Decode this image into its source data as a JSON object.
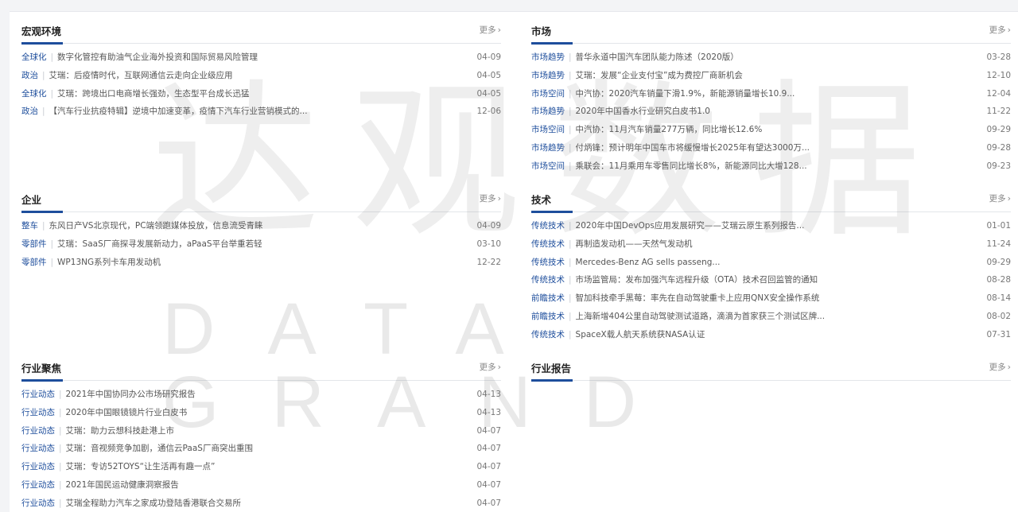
{
  "sections": [
    {
      "key": "macro",
      "title": "宏观环境",
      "more": "更多",
      "rows": [
        {
          "tag": "全球化",
          "text": "数字化管控有助油气企业海外投资和国际贸易风险管理",
          "date": "04-09"
        },
        {
          "tag": "政治",
          "text": "艾瑞：后疫情时代，互联网通信云走向企业级应用",
          "date": "04-05"
        },
        {
          "tag": "全球化",
          "text": "艾瑞：跨境出口电商增长强劲，生态型平台成长迅猛",
          "date": "04-05"
        },
        {
          "tag": "政治",
          "text": "【汽车行业抗疫特辑】逆境中加速变革，疫情下汽车行业营销模式的...",
          "date": "12-06"
        }
      ]
    },
    {
      "key": "market",
      "title": "市场",
      "more": "更多",
      "rows": [
        {
          "tag": "市场趋势",
          "text": "普华永道中国汽车团队能力陈述（2020版）",
          "date": "03-28"
        },
        {
          "tag": "市场趋势",
          "text": "艾瑞：发展“企业支付宝”成为费控厂商新机会",
          "date": "12-10"
        },
        {
          "tag": "市场空间",
          "text": "中汽协：2020汽车销量下滑1.9%，新能源销量增长10.9...",
          "date": "12-04"
        },
        {
          "tag": "市场趋势",
          "text": "2020年中国香水行业研究白皮书1.0",
          "date": "11-22"
        },
        {
          "tag": "市场空间",
          "text": "中汽协：11月汽车销量277万辆，同比增长12.6%",
          "date": "09-29"
        },
        {
          "tag": "市场趋势",
          "text": "付炳锋：预计明年中国车市将缓慢增长2025年有望达3000万...",
          "date": "09-28"
        },
        {
          "tag": "市场空间",
          "text": "乘联会：11月乘用车零售同比增长8%，新能源同比大增128...",
          "date": "09-23"
        }
      ]
    },
    {
      "key": "enterprise",
      "title": "企业",
      "more": "更多",
      "rows": [
        {
          "tag": "整车",
          "text": "东风日产VS北京现代，PC端领跑媒体投放，信息流受青睐",
          "date": "04-09"
        },
        {
          "tag": "零部件",
          "text": "艾瑞：SaaS厂商探寻发展新动力，aPaaS平台举重若轻",
          "date": "03-10"
        },
        {
          "tag": "零部件",
          "text": "WP13NG系列卡车用发动机",
          "date": "12-22"
        }
      ]
    },
    {
      "key": "tech",
      "title": "技术",
      "more": "更多",
      "rows": [
        {
          "tag": "传统技术",
          "text": "2020年中国DevOps应用发展研究——艾瑞云原生系列报告...",
          "date": "01-01"
        },
        {
          "tag": "传统技术",
          "text": "再制造发动机——天然气发动机",
          "date": "11-24"
        },
        {
          "tag": "传统技术",
          "text": "Mercedes-Benz AG sells passeng...",
          "date": "09-29"
        },
        {
          "tag": "传统技术",
          "text": "市场监管局：发布加强汽车远程升级（OTA）技术召回监管的通知",
          "date": "08-28"
        },
        {
          "tag": "前瞻技术",
          "text": "智加科技牵手黑莓：率先在自动驾驶重卡上应用QNX安全操作系统",
          "date": "08-14"
        },
        {
          "tag": "前瞻技术",
          "text": "上海新增404公里自动驾驶测试道路，滴滴为首家获三个测试区牌...",
          "date": "08-02"
        },
        {
          "tag": "传统技术",
          "text": "SpaceX载人航天系统获NASA认证",
          "date": "07-31"
        }
      ]
    },
    {
      "key": "focus",
      "title": "行业聚焦",
      "more": "更多",
      "rows": [
        {
          "tag": "行业动态",
          "text": "2021年中国协同办公市场研究报告",
          "date": "04-13"
        },
        {
          "tag": "行业动态",
          "text": "2020年中国眼镜镜片行业白皮书",
          "date": "04-13"
        },
        {
          "tag": "行业动态",
          "text": "艾瑞：助力云想科技赴港上市",
          "date": "04-07"
        },
        {
          "tag": "行业动态",
          "text": "艾瑞：音视频竞争加剧，通信云PaaS厂商突出重围",
          "date": "04-07"
        },
        {
          "tag": "行业动态",
          "text": "艾瑞：专访52TOYS“让生活再有趣一点”",
          "date": "04-07"
        },
        {
          "tag": "行业动态",
          "text": "2021年国民运动健康洞察报告",
          "date": "04-07"
        },
        {
          "tag": "行业动态",
          "text": "艾瑞全程助力汽车之家成功登陆香港联合交易所",
          "date": "04-07"
        }
      ]
    },
    {
      "key": "report",
      "title": "行业报告",
      "more": "更多",
      "rows": []
    }
  ],
  "watermark": {
    "cn": "达观数据",
    "en": "DATA GRAND"
  },
  "colors": {
    "accent": "#1e4e9c",
    "tag": "#1e4e9c",
    "text": "#555555",
    "date": "#777777"
  },
  "icons": {
    "more": "chevron-right-icon"
  }
}
